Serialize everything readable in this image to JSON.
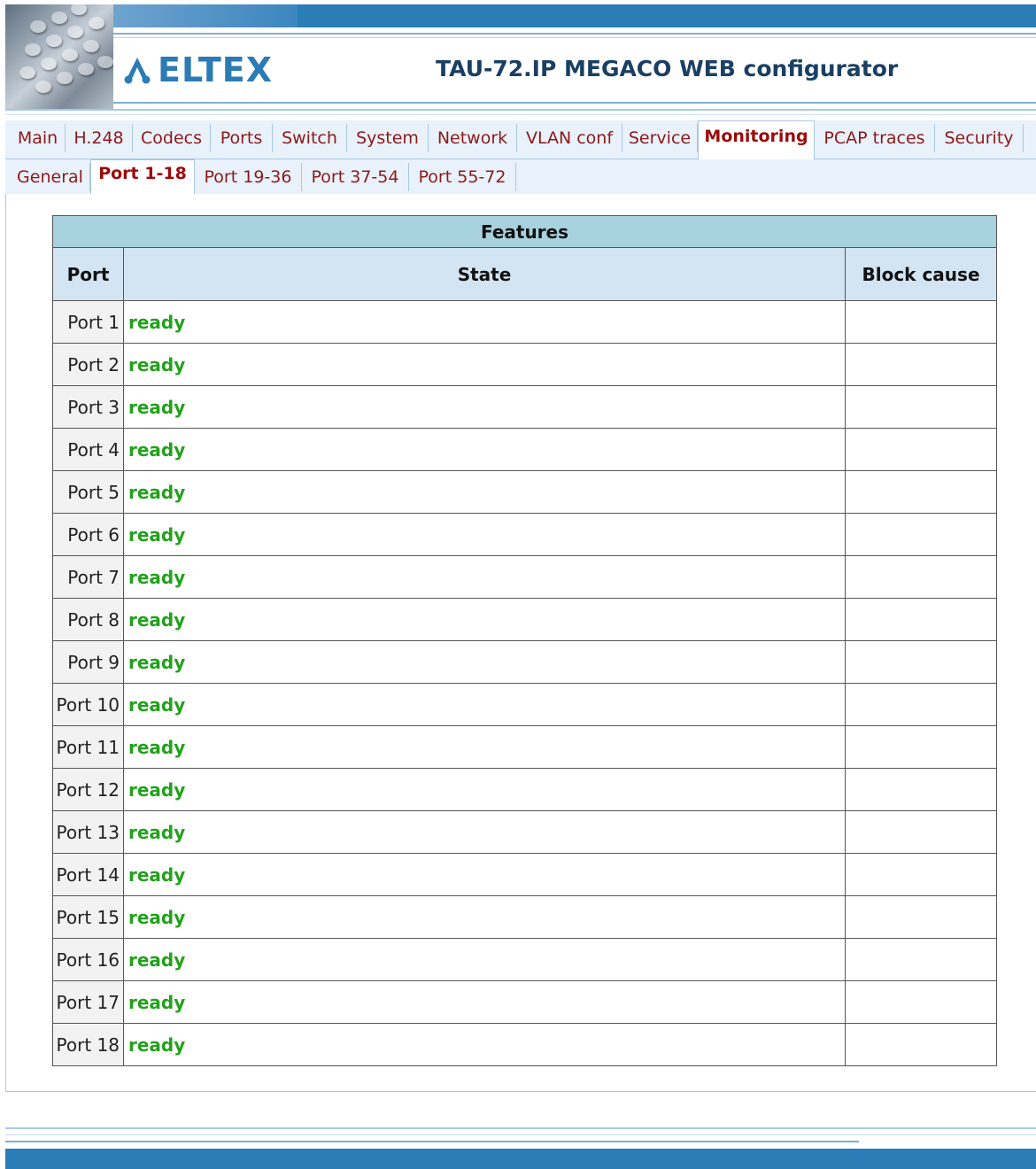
{
  "header": {
    "logo_text": "ELTEX",
    "app_title": "TAU-72.IP MEGACO WEB configurator"
  },
  "main_tabs": [
    {
      "label": "Main",
      "active": false
    },
    {
      "label": "H.248",
      "active": false
    },
    {
      "label": "Codecs",
      "active": false
    },
    {
      "label": "Ports",
      "active": false
    },
    {
      "label": "Switch",
      "active": false
    },
    {
      "label": "System",
      "active": false
    },
    {
      "label": "Network",
      "active": false
    },
    {
      "label": "VLAN conf",
      "active": false
    },
    {
      "label": "Service",
      "active": false
    },
    {
      "label": "Monitoring",
      "active": true
    },
    {
      "label": "PCAP traces",
      "active": false
    },
    {
      "label": "Security",
      "active": false
    }
  ],
  "sub_tabs": [
    {
      "label": "General",
      "active": false
    },
    {
      "label": "Port 1-18",
      "active": true
    },
    {
      "label": "Port 19-36",
      "active": false
    },
    {
      "label": "Port 37-54",
      "active": false
    },
    {
      "label": "Port 55-72",
      "active": false
    }
  ],
  "table": {
    "title": "Features",
    "columns": {
      "port": "Port",
      "state": "State",
      "cause": "Block cause"
    },
    "rows": [
      {
        "port": "Port 1",
        "state": "ready",
        "cause": ""
      },
      {
        "port": "Port 2",
        "state": "ready",
        "cause": ""
      },
      {
        "port": "Port 3",
        "state": "ready",
        "cause": ""
      },
      {
        "port": "Port 4",
        "state": "ready",
        "cause": ""
      },
      {
        "port": "Port 5",
        "state": "ready",
        "cause": ""
      },
      {
        "port": "Port 6",
        "state": "ready",
        "cause": ""
      },
      {
        "port": "Port 7",
        "state": "ready",
        "cause": ""
      },
      {
        "port": "Port 8",
        "state": "ready",
        "cause": ""
      },
      {
        "port": "Port 9",
        "state": "ready",
        "cause": ""
      },
      {
        "port": "Port 10",
        "state": "ready",
        "cause": ""
      },
      {
        "port": "Port 11",
        "state": "ready",
        "cause": ""
      },
      {
        "port": "Port 12",
        "state": "ready",
        "cause": ""
      },
      {
        "port": "Port 13",
        "state": "ready",
        "cause": ""
      },
      {
        "port": "Port 14",
        "state": "ready",
        "cause": ""
      },
      {
        "port": "Port 15",
        "state": "ready",
        "cause": ""
      },
      {
        "port": "Port 16",
        "state": "ready",
        "cause": ""
      },
      {
        "port": "Port 17",
        "state": "ready",
        "cause": ""
      },
      {
        "port": "Port 18",
        "state": "ready",
        "cause": ""
      }
    ]
  },
  "colors": {
    "brand_blue": "#2a7db7",
    "tab_text": "#8b1a1a",
    "ready_green": "#22a11b",
    "table_title_bg": "#a8d2de",
    "table_header_bg": "#d3e4f2"
  }
}
